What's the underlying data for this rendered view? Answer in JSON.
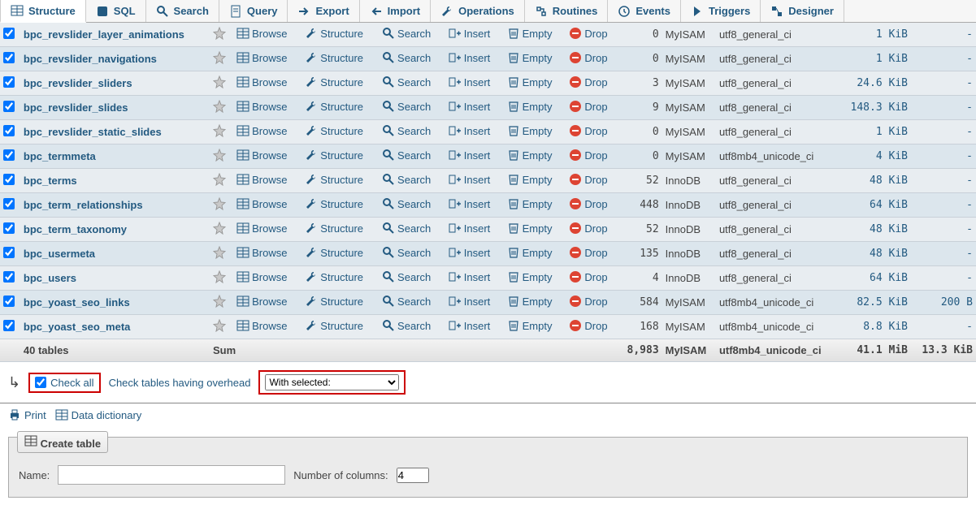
{
  "tabs": [
    {
      "label": "Structure"
    },
    {
      "label": "SQL"
    },
    {
      "label": "Search"
    },
    {
      "label": "Query"
    },
    {
      "label": "Export"
    },
    {
      "label": "Import"
    },
    {
      "label": "Operations"
    },
    {
      "label": "Routines"
    },
    {
      "label": "Events"
    },
    {
      "label": "Triggers"
    },
    {
      "label": "Designer"
    }
  ],
  "actions": {
    "browse": "Browse",
    "structure": "Structure",
    "search": "Search",
    "insert": "Insert",
    "empty": "Empty",
    "drop": "Drop"
  },
  "rows": [
    {
      "name": "bpc_revslider_layer_animations",
      "rows": "0",
      "engine": "MyISAM",
      "coll": "utf8_general_ci",
      "size": "1 KiB",
      "ovh": "-"
    },
    {
      "name": "bpc_revslider_navigations",
      "rows": "0",
      "engine": "MyISAM",
      "coll": "utf8_general_ci",
      "size": "1 KiB",
      "ovh": "-"
    },
    {
      "name": "bpc_revslider_sliders",
      "rows": "3",
      "engine": "MyISAM",
      "coll": "utf8_general_ci",
      "size": "24.6 KiB",
      "ovh": "-"
    },
    {
      "name": "bpc_revslider_slides",
      "rows": "9",
      "engine": "MyISAM",
      "coll": "utf8_general_ci",
      "size": "148.3 KiB",
      "ovh": "-"
    },
    {
      "name": "bpc_revslider_static_slides",
      "rows": "0",
      "engine": "MyISAM",
      "coll": "utf8_general_ci",
      "size": "1 KiB",
      "ovh": "-"
    },
    {
      "name": "bpc_termmeta",
      "rows": "0",
      "engine": "MyISAM",
      "coll": "utf8mb4_unicode_ci",
      "size": "4 KiB",
      "ovh": "-"
    },
    {
      "name": "bpc_terms",
      "rows": "52",
      "engine": "InnoDB",
      "coll": "utf8_general_ci",
      "size": "48 KiB",
      "ovh": "-"
    },
    {
      "name": "bpc_term_relationships",
      "rows": "448",
      "engine": "InnoDB",
      "coll": "utf8_general_ci",
      "size": "64 KiB",
      "ovh": "-"
    },
    {
      "name": "bpc_term_taxonomy",
      "rows": "52",
      "engine": "InnoDB",
      "coll": "utf8_general_ci",
      "size": "48 KiB",
      "ovh": "-"
    },
    {
      "name": "bpc_usermeta",
      "rows": "135",
      "engine": "InnoDB",
      "coll": "utf8_general_ci",
      "size": "48 KiB",
      "ovh": "-"
    },
    {
      "name": "bpc_users",
      "rows": "4",
      "engine": "InnoDB",
      "coll": "utf8_general_ci",
      "size": "64 KiB",
      "ovh": "-"
    },
    {
      "name": "bpc_yoast_seo_links",
      "rows": "584",
      "engine": "MyISAM",
      "coll": "utf8mb4_unicode_ci",
      "size": "82.5 KiB",
      "ovh": "200 B"
    },
    {
      "name": "bpc_yoast_seo_meta",
      "rows": "168",
      "engine": "MyISAM",
      "coll": "utf8mb4_unicode_ci",
      "size": "8.8 KiB",
      "ovh": "-"
    }
  ],
  "sum": {
    "label": "40 tables",
    "sum": "Sum",
    "rows": "8,983",
    "engine": "MyISAM",
    "coll": "utf8mb4_unicode_ci",
    "size": "41.1 MiB",
    "ovh": "13.3 KiB"
  },
  "footer": {
    "check_all": "Check all",
    "check_overhead": "Check tables having overhead",
    "with_selected": "With selected:",
    "print": "Print",
    "data_dict": "Data dictionary",
    "create_table": "Create table",
    "name_lbl": "Name:",
    "cols_lbl": "Number of columns:",
    "cols_val": "4"
  }
}
